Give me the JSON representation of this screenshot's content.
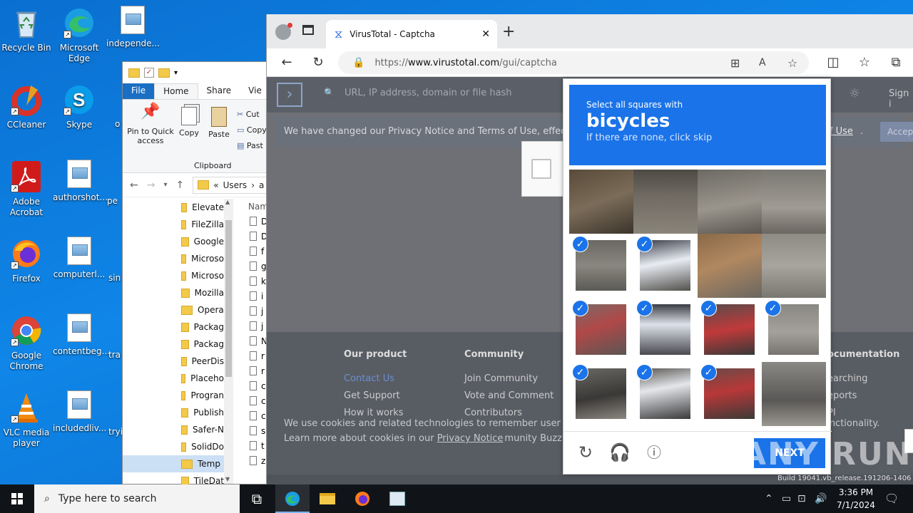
{
  "desktop": {
    "icons": [
      {
        "label": "Recycle Bin"
      },
      {
        "label": "Microsoft Edge"
      },
      {
        "label": "independe..."
      },
      {
        "label": "CCleaner"
      },
      {
        "label": "Skype"
      },
      {
        "label": "Adobe Acrobat"
      },
      {
        "label": "authorshot...."
      },
      {
        "label": "Firefox"
      },
      {
        "label": "computerl..."
      },
      {
        "label": "Google Chrome"
      },
      {
        "label": "contentbeg..."
      },
      {
        "label": "VLC media player"
      },
      {
        "label": "includedliv..."
      }
    ],
    "partial_labels": [
      "pe",
      "sin",
      "tra",
      "tryi",
      "o"
    ]
  },
  "explorer": {
    "tabs": {
      "file": "File",
      "home": "Home",
      "share": "Share",
      "view": "Vie"
    },
    "ribbon": {
      "pin": "Pin to Quick access",
      "copy": "Copy",
      "paste": "Paste",
      "cut": "Cut",
      "copy_path": "Copy",
      "paste_shortcut": "Past",
      "group": "Clipboard"
    },
    "address": {
      "sep": "«",
      "crumb": "Users",
      "next": "a"
    },
    "nav_items": [
      "Elevate",
      "FileZilla",
      "Google",
      "Microso",
      "Microso",
      "Mozilla",
      "Opera",
      "Packag",
      "Packag",
      "PeerDis",
      "Placeho",
      "Progran",
      "Publish",
      "Safer-N",
      "SolidDo",
      "Temp",
      "TileDat"
    ],
    "selected_nav": "Temp",
    "file_header": "Nam",
    "file_rows": [
      "D",
      "D",
      "f",
      "g",
      "k",
      "i",
      "j",
      "j",
      "N",
      "r",
      "r",
      "c",
      "c",
      "c",
      "s",
      "t",
      "z"
    ]
  },
  "browser": {
    "tab_title": "VirusTotal - Captcha",
    "url_prefix": "https://",
    "url_host": "www.virustotal.com",
    "url_path": "/gui/captcha",
    "page": {
      "search_placeholder": "URL, IP address, domain or file hash",
      "sign_in": "Sign i",
      "banner_text": "We have changed our Privacy Notice and Terms of Use, effective Ju",
      "banner_link": "s of Use",
      "banner_button": "Accep",
      "footer": {
        "col1_title": "Our product",
        "col1_items": [
          "Contact Us",
          "Get Support",
          "How it works"
        ],
        "col2_title": "Community",
        "col2_items": [
          "Join Community",
          "Vote and Comment",
          "Contributors"
        ],
        "col4_title": "ocumentation",
        "col4_items": [
          "earching",
          "eports",
          "PI"
        ]
      },
      "cookie_line1": "We use cookies and related technologies to remember user prefer",
      "cookie_line1_end": "functionality.",
      "cookie_line2": "Learn more about cookies in our",
      "cookie_link": "Privacy Notice",
      "cookie_tail": "munity Buzz"
    }
  },
  "captcha": {
    "instruction": "Select all squares with",
    "target": "bicycles",
    "hint": "If there are none, click skip",
    "next_label": "NEXT",
    "tiles_selected": [
      false,
      false,
      false,
      false,
      true,
      true,
      false,
      false,
      true,
      true,
      true,
      true,
      true,
      true,
      true,
      false
    ]
  },
  "watermark": "ANY RUN",
  "taskbar": {
    "search_placeholder": "Type here to search",
    "time": "3:36 PM",
    "date": "7/1/2024",
    "build_text": "Build 19041.vb_release.191206-1406"
  },
  "colors": {
    "desktop_blue": "#0f86e8",
    "accent": "#1a73e8",
    "taskbar": "#101418"
  }
}
